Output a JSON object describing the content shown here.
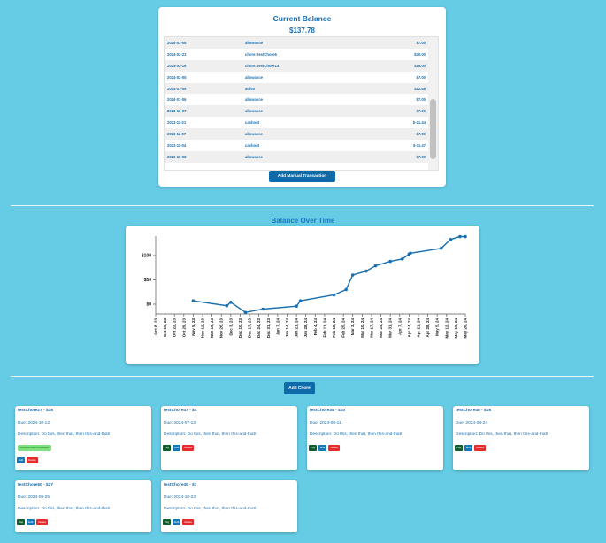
{
  "balance": {
    "title": "Current Balance",
    "amount": "$137.78",
    "add_button": "Add Manual Transaction",
    "transactions": [
      {
        "date": "2024-03-06",
        "desc": "allowance",
        "amount": "$7.00"
      },
      {
        "date": "2024-02-23",
        "desc": "chore: testChore6",
        "amount": "$30.00"
      },
      {
        "date": "2024-02-16",
        "desc": "chore: testChore14",
        "amount": "$15.00"
      },
      {
        "date": "2024-02-05",
        "desc": "allowance",
        "amount": "$7.00"
      },
      {
        "date": "2024-01-09",
        "desc": "adfso",
        "amount": "$12.68"
      },
      {
        "date": "2024-01-06",
        "desc": "allowance",
        "amount": "$7.00"
      },
      {
        "date": "2023-12-07",
        "desc": "allowance",
        "amount": "$7.00"
      },
      {
        "date": "2023-11-21",
        "desc": "cashout",
        "amount": "$-21.44"
      },
      {
        "date": "2023-11-07",
        "desc": "allowance",
        "amount": "$7.00"
      },
      {
        "date": "2023-11-04",
        "desc": "cashout",
        "amount": "$-11.47"
      },
      {
        "date": "2023-10-08",
        "desc": "allowance",
        "amount": "$7.00"
      }
    ]
  },
  "chart_title": "Balance Over Time",
  "chart_data": {
    "type": "line",
    "title": "Balance Over Time",
    "color": "#1a6fb0",
    "y_ticks": [
      "$0",
      "$50",
      "$100"
    ],
    "ylim": [
      -20,
      140
    ],
    "xlim": [
      0,
      231
    ],
    "x_ticks": [
      "Oct 8, 23",
      "Oct 15, 23",
      "Oct 22, 23",
      "Oct 29, 23",
      "Nov 5, 23",
      "Nov 12, 23",
      "Nov 19, 23",
      "Nov 26, 23",
      "Dec 3, 23",
      "Dec 10, 23",
      "Dec 17, 23",
      "Dec 24, 23",
      "Dec 31, 23",
      "Jan 7, 24",
      "Jan 14, 24",
      "Jan 21, 24",
      "Jan 28, 24",
      "Feb 4, 24",
      "Feb 11, 24",
      "Feb 18, 24",
      "Feb 25, 24",
      "Mar 3, 24",
      "Mar 10, 24",
      "Mar 17, 24",
      "Mar 24, 24",
      "Mar 31, 24",
      "Apr 7, 24",
      "Apr 14, 24",
      "Apr 21, 24",
      "Apr 28, 24",
      "May 5, 24",
      "May 12, 24",
      "May 19, 24",
      "May 26, 24"
    ],
    "x_tick_values": [
      0,
      7,
      14,
      21,
      28,
      35,
      42,
      49,
      56,
      63,
      70,
      77,
      84,
      91,
      98,
      105,
      112,
      119,
      126,
      133,
      140,
      147,
      154,
      161,
      168,
      175,
      182,
      189,
      196,
      203,
      210,
      217,
      224,
      231
    ],
    "x": [
      28,
      53,
      56,
      67,
      80,
      105,
      108,
      133,
      142,
      147,
      157,
      164,
      175,
      184,
      189,
      190,
      213,
      220,
      227,
      231
    ],
    "y": [
      7,
      -3,
      4,
      -17,
      -10,
      -4,
      7,
      19,
      30,
      60,
      68,
      79,
      88,
      93,
      103,
      105,
      115,
      133,
      139,
      139
    ]
  },
  "add_chore_button": "Add Chore",
  "chores": [
    {
      "title": "testChore27 - $16",
      "due": "Due: 2024-10-12",
      "desc": "Description: Do this, then that, then this-and-that!",
      "accepted": "Accepted as Completed",
      "buttons": [
        "Edit",
        "Delete"
      ]
    },
    {
      "title": "testChore47 - $4",
      "due": "Due: 2024-07-13",
      "desc": "Description: Do this, then that, then this-and-that!",
      "buttons": [
        "Pay",
        "Edit",
        "Delete"
      ]
    },
    {
      "title": "testChore34 - $10",
      "due": "Due: 2024-08-11",
      "desc": "Description: Do this, then that, then this-and-that!",
      "buttons": [
        "Pay",
        "Edit",
        "Delete"
      ]
    },
    {
      "title": "testChore45 - $16",
      "due": "Due: 2024-08-24",
      "desc": "Description: Do this, then that, then this-and-that!",
      "buttons": [
        "Pay",
        "Edit",
        "Delete"
      ]
    },
    {
      "title": "testChore50 - $27",
      "due": "Due: 2024-09-25",
      "desc": "Description: Do this, then that, then this-and-that!",
      "buttons": [
        "Pay",
        "Edit",
        "Delete"
      ]
    },
    {
      "title": "testChore40 - $7",
      "due": "Due: 2024-10-23",
      "desc": "Description: Do this, then that, then this-and-that!",
      "buttons": [
        "Pay",
        "Edit",
        "Delete"
      ]
    }
  ]
}
